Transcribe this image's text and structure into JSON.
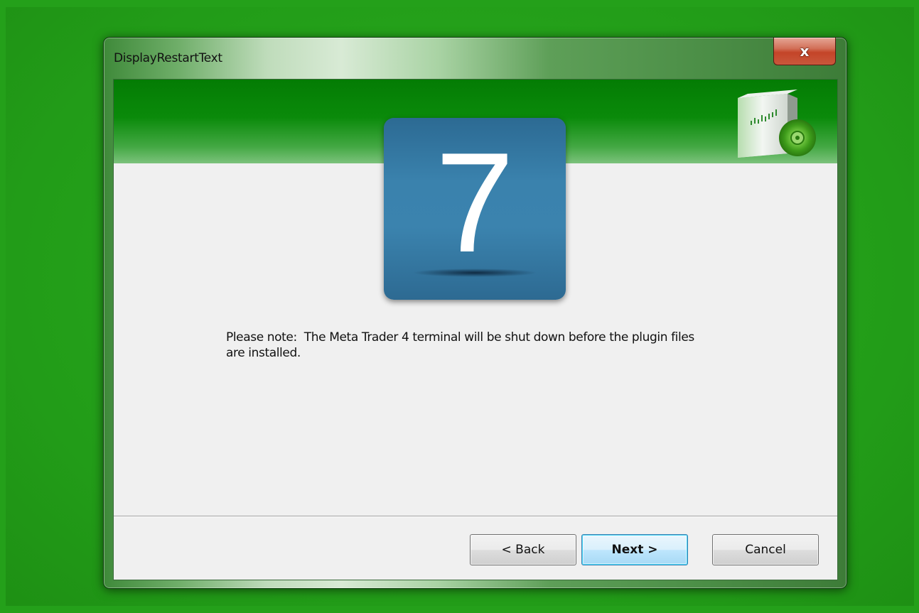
{
  "window": {
    "title": "DisplayRestartText",
    "close_label": "x"
  },
  "banner": {
    "product_icon": "software-box-with-cd-icon"
  },
  "step": {
    "number": "7"
  },
  "message": {
    "text": "Please note:  The Meta Trader 4 terminal will be shut down before the plugin files\nare installed."
  },
  "buttons": {
    "back_label": "< Back",
    "next_label": "Next >",
    "cancel_label": "Cancel"
  },
  "colors": {
    "desktop_background": "#24a01a",
    "banner_green": "#047c04",
    "step_tile_blue": "#3a82ad",
    "close_button_red": "#c44428"
  }
}
